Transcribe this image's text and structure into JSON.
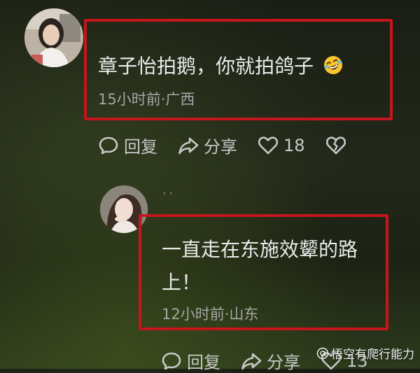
{
  "comments": [
    {
      "text": "章子怡拍鹅，你就拍鸽子",
      "emoji": "rofl-emoji",
      "meta": "15小时前·广西",
      "actions": {
        "reply_label": "回复",
        "share_label": "分享",
        "like_count": "18"
      }
    },
    {
      "text": "一直走在东施效颦的路上！",
      "meta": "12小时前·山东",
      "actions": {
        "reply_label": "回复",
        "share_label": "分享",
        "like_count": "13"
      }
    }
  ],
  "watermark": {
    "text": "悟空有爬行能力"
  },
  "colors": {
    "highlight_box": "#c4161c",
    "comment_text": "#eaeaea",
    "meta_text": "#a6a6a6"
  }
}
